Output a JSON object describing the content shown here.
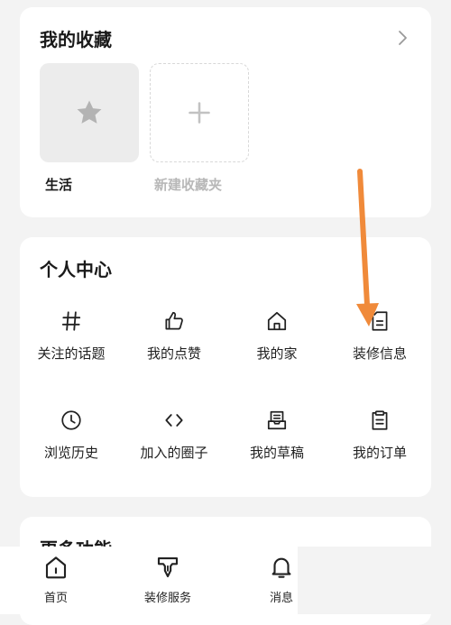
{
  "favorites": {
    "title": "我的收藏",
    "items": [
      {
        "label": "生活",
        "icon": "star-icon"
      },
      {
        "label": "新建收藏夹",
        "icon": "plus-icon"
      }
    ]
  },
  "personal_center": {
    "title": "个人中心",
    "items": [
      {
        "label": "关注的话题",
        "icon": "hash-icon"
      },
      {
        "label": "我的点赞",
        "icon": "thumbs-up-icon"
      },
      {
        "label": "我的家",
        "icon": "home-icon"
      },
      {
        "label": "装修信息",
        "icon": "document-icon"
      },
      {
        "label": "浏览历史",
        "icon": "clock-icon"
      },
      {
        "label": "加入的圈子",
        "icon": "code-icon"
      },
      {
        "label": "我的草稿",
        "icon": "drafts-icon"
      },
      {
        "label": "我的订单",
        "icon": "clipboard-icon"
      }
    ]
  },
  "more": {
    "title": "更多功能"
  },
  "bottom_nav": {
    "items": [
      {
        "label": "首页",
        "icon": "home-tab-icon"
      },
      {
        "label": "装修服务",
        "icon": "service-icon"
      },
      {
        "label": "消息",
        "icon": "bell-icon"
      }
    ]
  },
  "colors": {
    "accent_arrow": "#f08a3a",
    "background": "#f3f3f3",
    "card": "#ffffff"
  }
}
